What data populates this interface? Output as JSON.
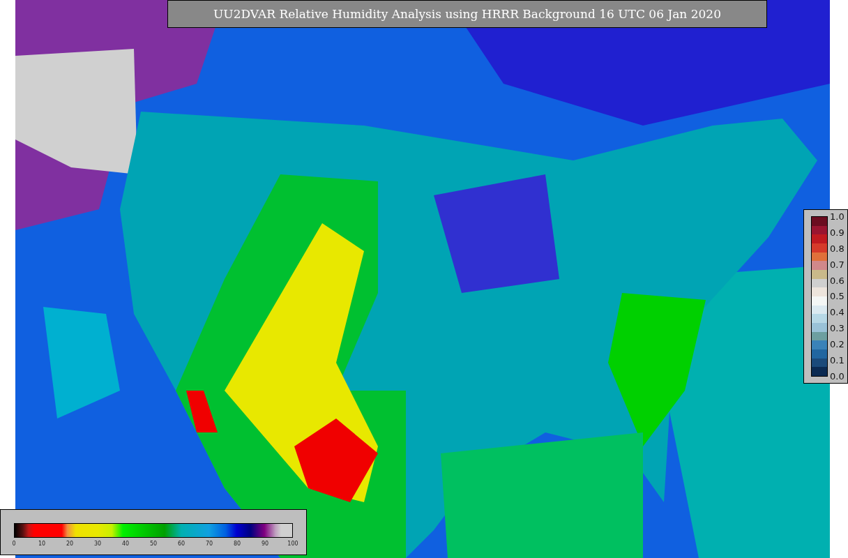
{
  "title": "UU2DVAR Relative Humidity Analysis using HRRR Background 16 UTC 06 Jan 2020",
  "right_colorbar": {
    "ticks": [
      "1.0",
      "0.9",
      "0.8",
      "0.7",
      "0.6",
      "0.5",
      "0.4",
      "0.3",
      "0.2",
      "0.1",
      "0.0"
    ]
  },
  "bottom_colorbar": {
    "ticks": [
      "0",
      "10",
      "20",
      "30",
      "40",
      "50",
      "60",
      "70",
      "80",
      "90",
      "100"
    ]
  }
}
